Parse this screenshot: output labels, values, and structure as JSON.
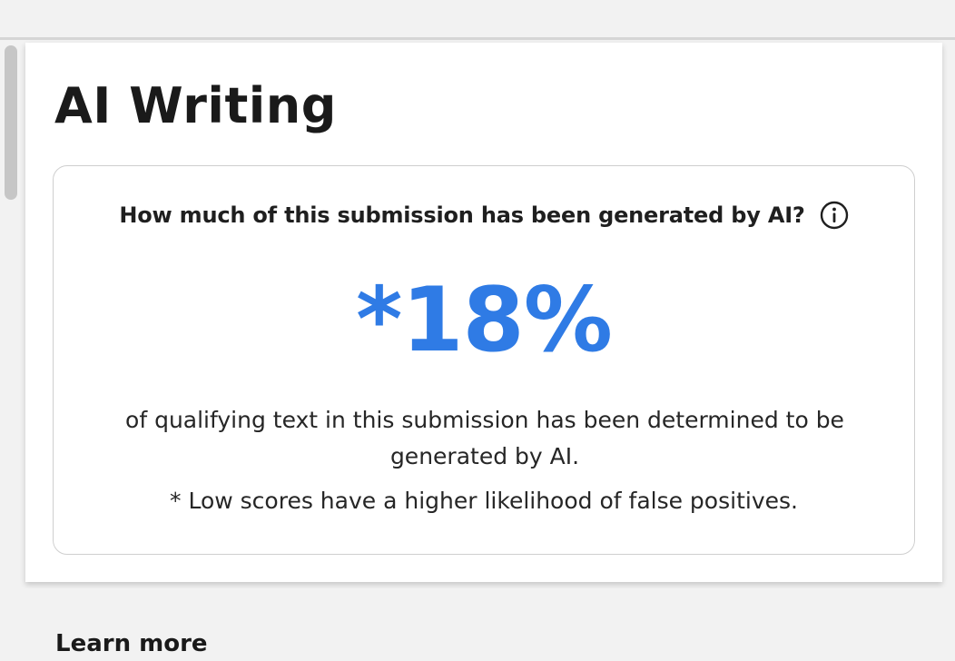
{
  "panel": {
    "title": "AI Writing"
  },
  "card": {
    "question": "How much of this submission has been generated by AI?",
    "info_icon": "info-icon",
    "score": "*18%",
    "description": "of qualifying text in this submission has been determined to be generated by AI.",
    "disclaimer": "* Low scores have a higher likelihood of false positives."
  },
  "learn_more": {
    "title": "Learn more"
  },
  "colors": {
    "score": "#2f7be5",
    "card_border": "#cfcfcf",
    "background": "#f2f2f2"
  }
}
